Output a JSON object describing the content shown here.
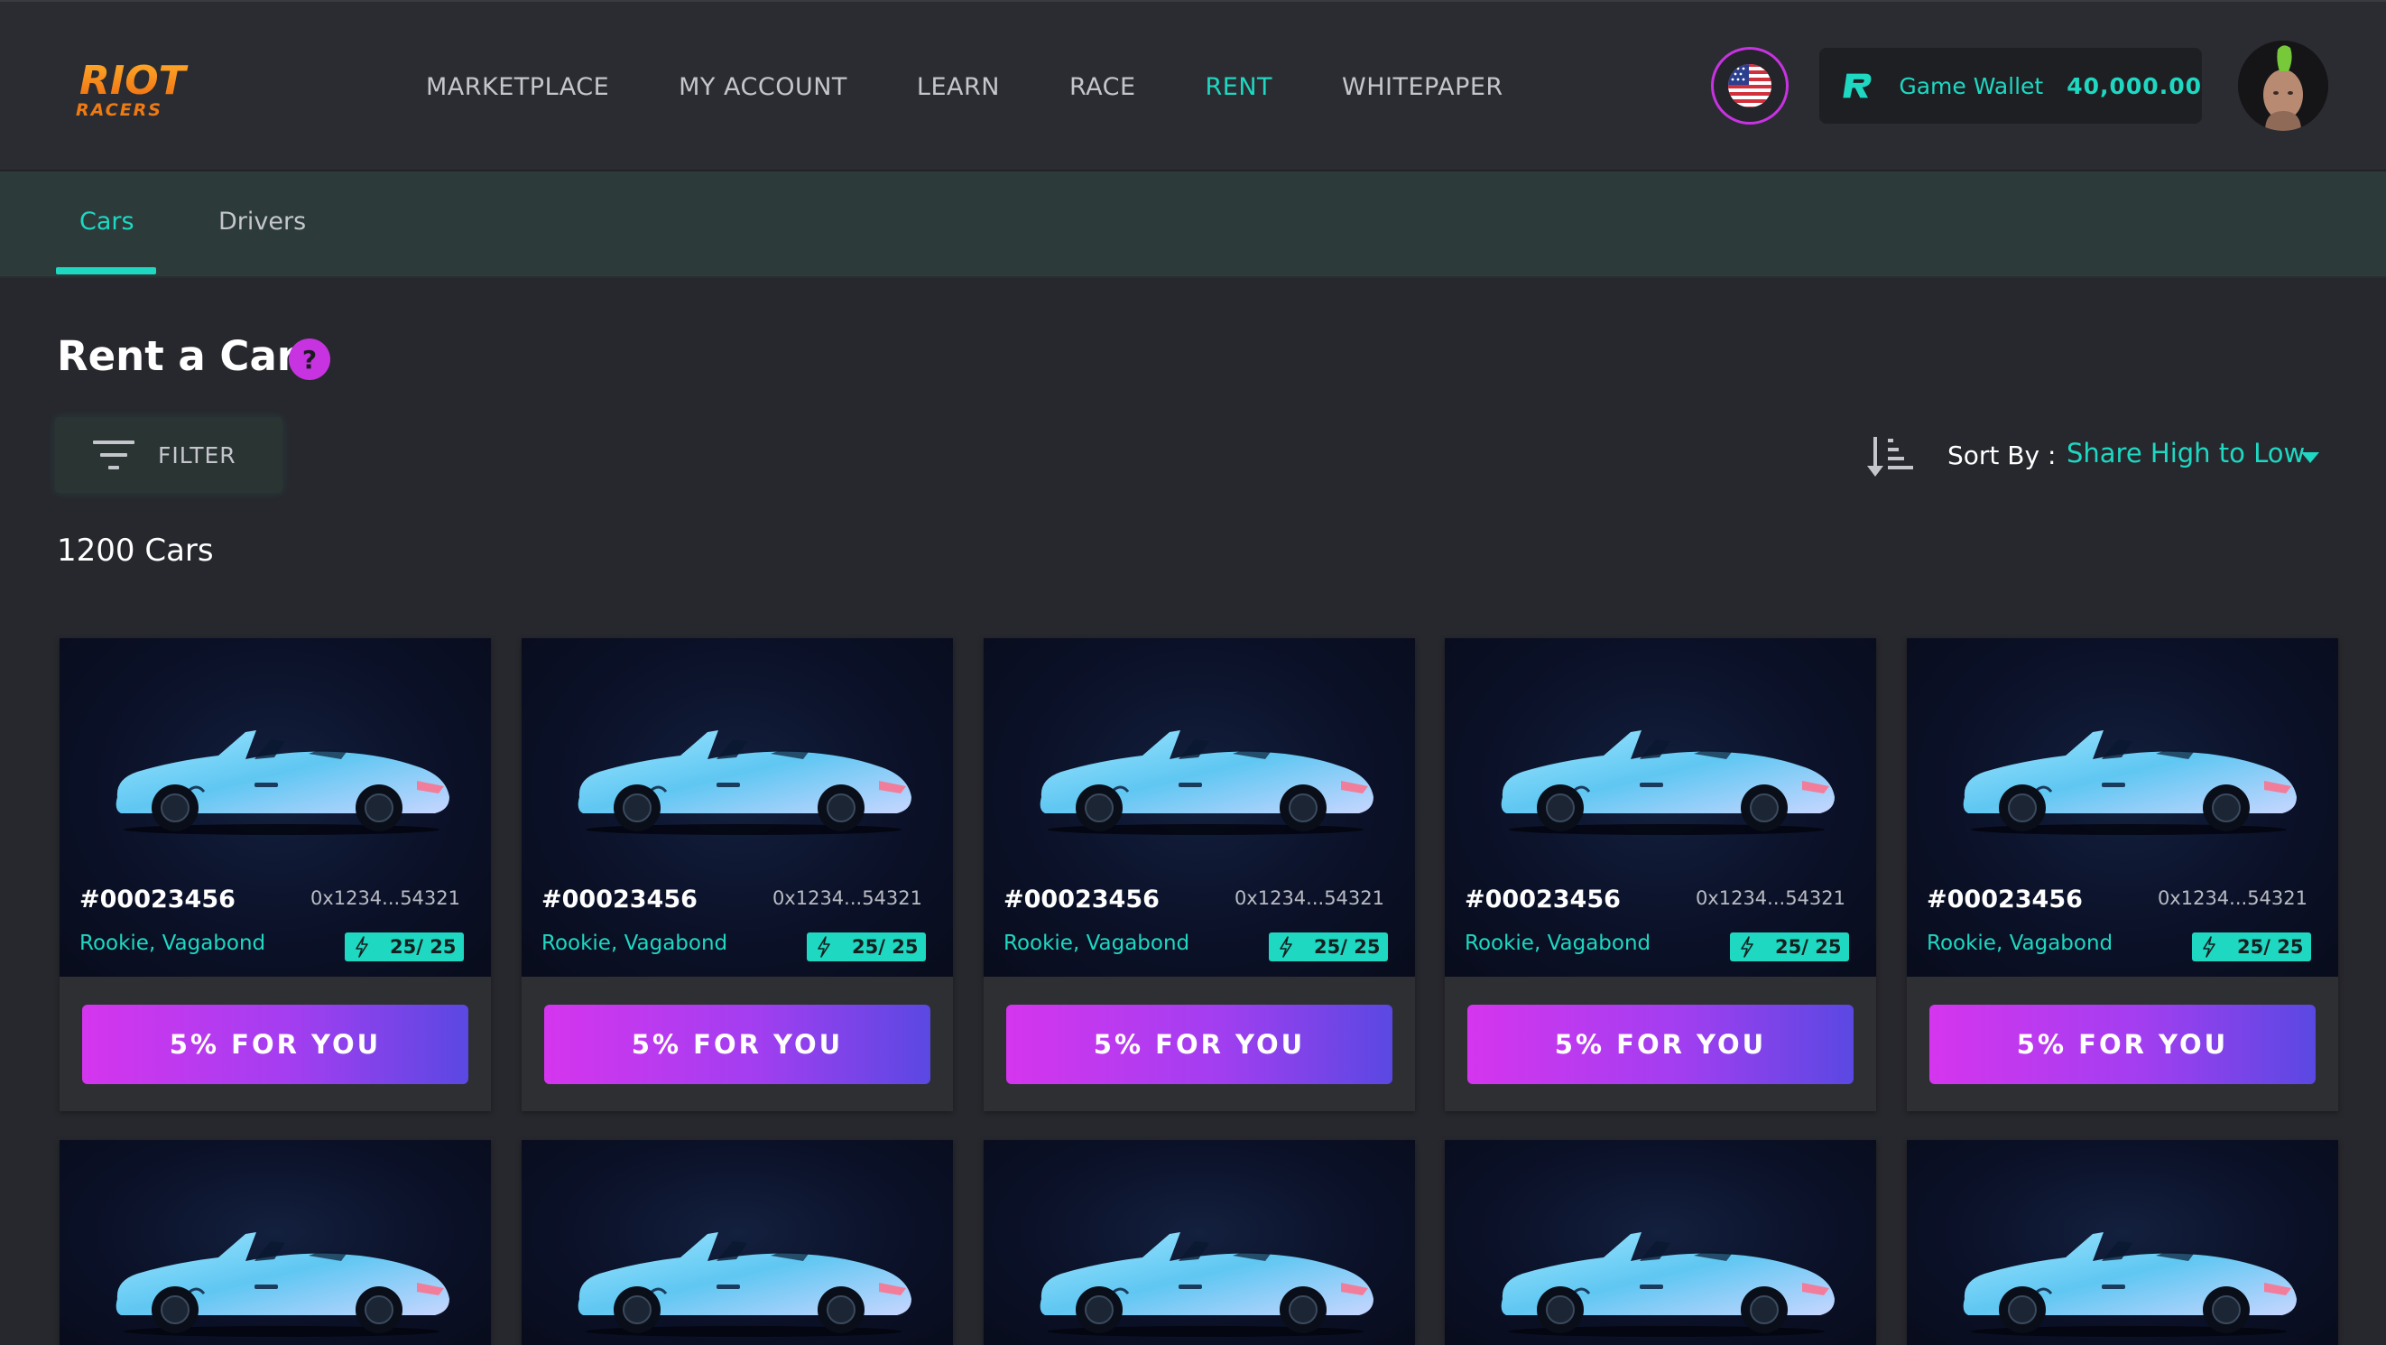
{
  "brand": {
    "name_top": "RIOT",
    "name_bottom": "RACERS"
  },
  "nav": {
    "items": [
      {
        "label": "MARKETPLACE",
        "active": false
      },
      {
        "label": "MY ACCOUNT",
        "active": false
      },
      {
        "label": "LEARN",
        "active": false
      },
      {
        "label": "RACE",
        "active": false
      },
      {
        "label": "RENT",
        "active": true
      },
      {
        "label": "WHITEPAPER",
        "active": false
      }
    ]
  },
  "language": {
    "icon": "us-flag-icon"
  },
  "wallet": {
    "label": "Game Wallet",
    "amount": "40,000.00"
  },
  "subtabs": [
    {
      "label": "Cars",
      "active": true
    },
    {
      "label": "Drivers",
      "active": false
    }
  ],
  "page": {
    "title": "Rent a Car",
    "help": "?",
    "filter_label": "FILTER",
    "sort_label": "Sort By :",
    "sort_value": "Share High to Low",
    "count": "1200 Cars"
  },
  "cards": [
    {
      "id": "#00023456",
      "address": "0x1234...54321",
      "type": "Rookie, Vagabond",
      "energy": "25/ 25",
      "button": "5% FOR YOU"
    },
    {
      "id": "#00023456",
      "address": "0x1234...54321",
      "type": "Rookie, Vagabond",
      "energy": "25/ 25",
      "button": "5% FOR YOU"
    },
    {
      "id": "#00023456",
      "address": "0x1234...54321",
      "type": "Rookie, Vagabond",
      "energy": "25/ 25",
      "button": "5% FOR YOU"
    },
    {
      "id": "#00023456",
      "address": "0x1234...54321",
      "type": "Rookie, Vagabond",
      "energy": "25/ 25",
      "button": "5% FOR YOU"
    },
    {
      "id": "#00023456",
      "address": "0x1234...54321",
      "type": "Rookie, Vagabond",
      "energy": "25/ 25",
      "button": "5% FOR YOU"
    }
  ],
  "colors": {
    "background": "#27282d",
    "header": "#2b2c31",
    "accent_teal": "#1ed8c2",
    "accent_magenta": "#c733e0",
    "button_gradient_start": "#d535ee",
    "button_gradient_end": "#5a48e2"
  }
}
